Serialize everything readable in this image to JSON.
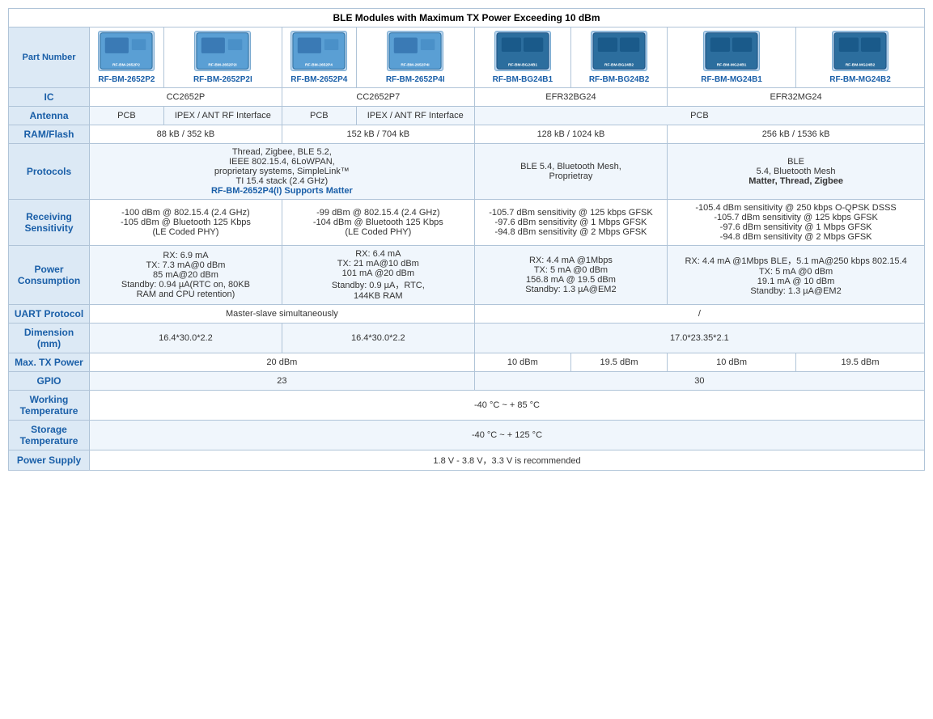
{
  "title": "BLE Modules with Maximum TX Power Exceeding 10 dBm",
  "columns": {
    "part_numbers": [
      "RF-BM-2652P2",
      "RF-BM-2652P2I",
      "RF-BM-2652P4",
      "RF-BM-2652P4I",
      "RF-BM-BG24B1",
      "RF-BM-BG24B2",
      "RF-BM-MG24B1",
      "RF-BM-MG24B2"
    ],
    "ic": {
      "col1": "CC2652P",
      "col2": "CC2652P7",
      "col3": "EFR32BG24",
      "col4": "EFR32MG24"
    },
    "antenna": {
      "col1_1": "PCB",
      "col1_2": "IPEX / ANT RF Interface",
      "col2_1": "PCB",
      "col2_2": "IPEX / ANT RF Interface",
      "col3": "PCB"
    },
    "ram_flash": {
      "col1": "88 kB / 352 kB",
      "col2": "152 kB / 704 kB",
      "col3": "128 kB / 1024 kB",
      "col4": "256 kB / 1536 kB"
    },
    "protocols": {
      "col1": "Thread, Zigbee, BLE 5.2,\nIEEE 802.15.4, 6LoWPAN,\nproprietary systems, SimpleLink™\nTI 15.4 stack (2.4 GHz)",
      "col1_bold": "RF-BM-2652P4(I) Supports Matter",
      "col2": "BLE 5.4, Bluetooth Mesh,\nProprietray",
      "col3": "BLE\n5.4, Bluetooth Mesh\nMatter, Thread, Zigbee"
    },
    "receiving_sensitivity": {
      "col1": "-100 dBm @ 802.15.4 (2.4 GHz)\n-105 dBm @ Bluetooth 125 Kbps\n(LE Coded PHY)",
      "col2": "-99 dBm @ 802.15.4 (2.4 GHz)\n-104 dBm @ Bluetooth 125 Kbps\n(LE Coded PHY)",
      "col3": "-105.7 dBm sensitivity @ 125 kbps GFSK\n-97.6 dBm sensitivity @ 1 Mbps GFSK\n-94.8 dBm sensitivity @ 2 Mbps GFSK",
      "col4": "-105.4 dBm sensitivity @ 250 kbps O-QPSK DSSS\n-105.7 dBm sensitivity @ 125 kbps GFSK\n-97.6 dBm sensitivity @ 1 Mbps GFSK\n-94.8 dBm sensitivity @ 2 Mbps GFSK"
    },
    "power_consumption": {
      "col1": "RX: 6.9 mA\nTX: 7.3 mA@0 dBm\n85 mA@20 dBm\nStandby: 0.94 µA(RTC on, 80KB\nRAM and CPU retention)",
      "col2": "RX: 6.4 mA\nTX: 21 mA@10 dBm\n101 mA @20 dBm\nStandby: 0.9 µA，RTC,\n144KB RAM",
      "col3": "RX: 4.4 mA @1Mbps\nTX: 5 mA @0 dBm\n156.8 mA @ 19.5 dBm\nStandby: 1.3 µA@EM2",
      "col4": "RX: 4.4 mA @1Mbps BLE，5.1 mA@250 kbps 802.15.4\nTX: 5 mA @0 dBm\n19.1 mA @ 10 dBm\nStandby: 1.3 µA@EM2"
    },
    "uart_protocol": {
      "col1": "Master-slave simultaneously",
      "col2": "/"
    },
    "dimension": {
      "col1": "16.4*30.0*2.2",
      "col2": "16.4*30.0*2.2",
      "col3": "17.0*23.35*2.1"
    },
    "max_tx_power": {
      "col1": "20 dBm",
      "col2_bg24b1": "10 dBm",
      "col2_bg24b2": "19.5 dBm",
      "col2_mg24b1": "10 dBm",
      "col2_mg24b2": "19.5 dBm"
    },
    "gpio": {
      "col1": "23",
      "col2": "30"
    },
    "working_temp": "-40 °C ~ + 85 °C",
    "storage_temp": "-40 °C ~ + 125 °C",
    "power_supply": "1.8 V - 3.8 V，3.3 V is recommended"
  },
  "row_labels": {
    "part_number": "Part Number",
    "ic": "IC",
    "antenna": "Antenna",
    "ram_flash": "RAM/Flash",
    "protocols": "Protocols",
    "receiving_sensitivity": "Receiving Sensitivity",
    "power_consumption": "Power Consumption",
    "uart_protocol": "UART Protocol",
    "dimension": "Dimension (mm)",
    "max_tx_power": "Max. TX Power",
    "gpio": "GPIO",
    "working_temp": "Working Temperature",
    "storage_temp": "Storage Temperature",
    "power_supply": "Power Supply"
  }
}
